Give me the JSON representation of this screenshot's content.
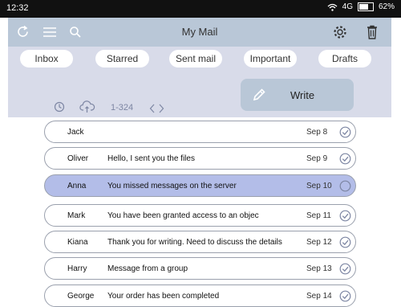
{
  "status": {
    "time": "12:32",
    "network": "4G",
    "battery": "62%",
    "battery_level": 0.62
  },
  "header": {
    "title": "My Mail",
    "icons": [
      "refresh-icon",
      "menu-icon",
      "search-icon",
      "settings-icon",
      "trash-icon"
    ]
  },
  "tabs": [
    "Inbox",
    "Starred",
    "Sent mail",
    "Important",
    "Drafts"
  ],
  "toolbar": {
    "range": "1-324",
    "write_label": "Write",
    "icons": [
      "clock-icon",
      "cloud-upload-icon",
      "chevron-left-icon",
      "chevron-right-icon",
      "pencil-icon"
    ]
  },
  "emails": [
    {
      "sender": "Jack",
      "subject": "",
      "date": "Sep 8",
      "checked": true,
      "selected": false
    },
    {
      "sender": "Oliver",
      "subject": "Hello, I sent you the files",
      "date": "Sep 9",
      "checked": true,
      "selected": false
    },
    {
      "sender": "Anna",
      "subject": "You missed messages on the server",
      "date": "Sep 10",
      "checked": false,
      "selected": true
    },
    {
      "sender": "Mark",
      "subject": "You have been granted access to an objec",
      "date": "Sep 11",
      "checked": true,
      "selected": false
    },
    {
      "sender": "Kiana",
      "subject": "Thank you for writing. Need to discuss the details",
      "date": "Sep 12",
      "checked": true,
      "selected": false
    },
    {
      "sender": "Harry",
      "subject": "Message from a group",
      "date": "Sep 13",
      "checked": true,
      "selected": false
    },
    {
      "sender": "George",
      "subject": "Your order has been completed",
      "date": "Sep 14",
      "checked": true,
      "selected": false
    }
  ]
}
